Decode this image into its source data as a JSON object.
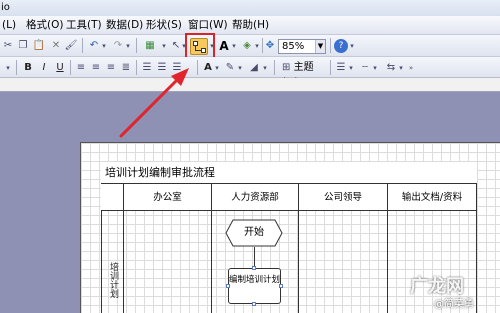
{
  "window": {
    "title": "io"
  },
  "menu": {
    "items": [
      {
        "label": "(L)"
      },
      {
        "label": "格式(O)"
      },
      {
        "label": "工具(T)"
      },
      {
        "label": "数据(D)"
      },
      {
        "label": "形状(S)"
      },
      {
        "label": "窗口(W)"
      },
      {
        "label": "帮助(H)"
      }
    ]
  },
  "toolbar": {
    "zoom_value": "85%",
    "theme_label": "主题(M)",
    "bold": "B",
    "italic": "I",
    "underline": "U",
    "text_a": "A",
    "connector_tool": "connector-tool-icon"
  },
  "document": {
    "title": "培训计划编制审批流程",
    "columns": [
      "办公室",
      "人力资源部",
      "公司领导",
      "输出文档/资料"
    ],
    "lane_label": "培训计划",
    "start_label": "开始",
    "task_label": "编制培训计划"
  },
  "watermark": {
    "logo": "广龙网",
    "credit": "@简英勇"
  },
  "colors": {
    "highlight": "#d8252b",
    "arrow": "#e0262c",
    "connector_button": "#f7c95c"
  }
}
